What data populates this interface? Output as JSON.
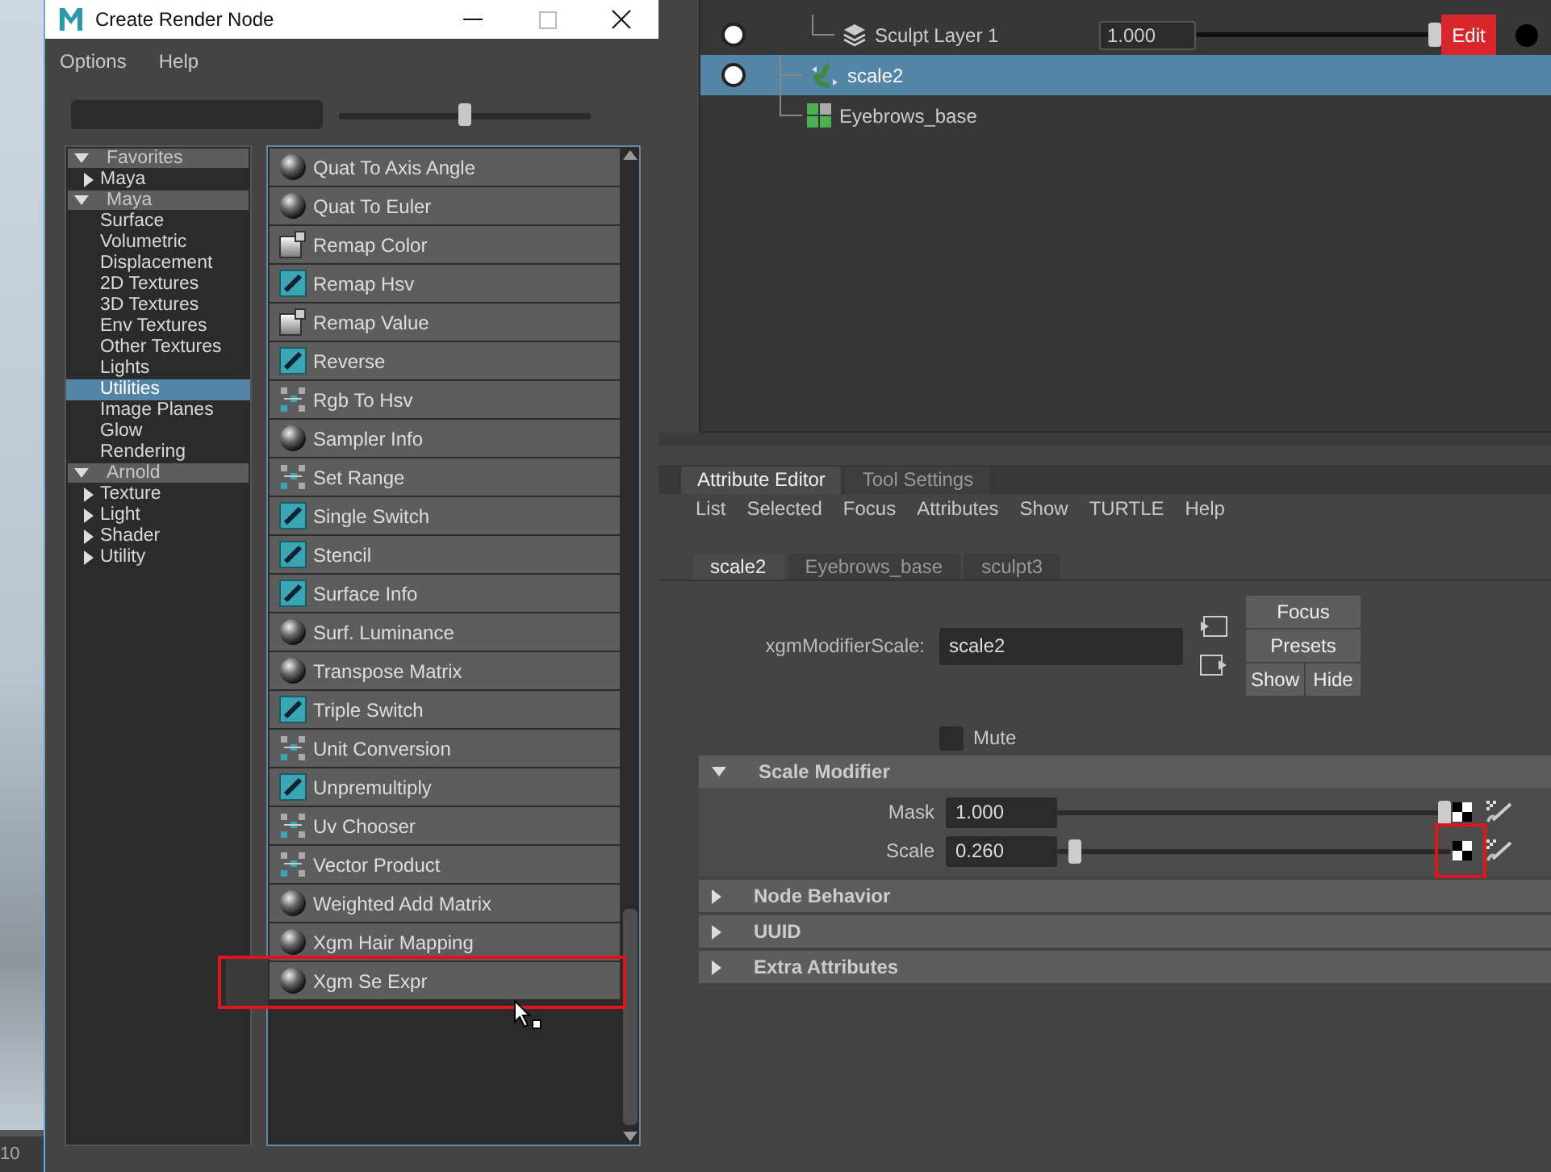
{
  "desktop": {
    "corner_text": "10"
  },
  "create_render_node": {
    "window": {
      "title": "Create Render Node"
    },
    "menu": [
      "Options",
      "Help"
    ],
    "size_slider": {
      "level": 0.5
    },
    "tree": [
      {
        "label": "Favorites",
        "expanded": true,
        "selected": false,
        "children": [
          {
            "label": "Maya",
            "expanded": false,
            "selected": false
          }
        ]
      },
      {
        "label": "Maya",
        "expanded": true,
        "selected": false,
        "children": [
          {
            "label": "Surface",
            "selected": false
          },
          {
            "label": "Volumetric",
            "selected": false
          },
          {
            "label": "Displacement",
            "selected": false
          },
          {
            "label": "2D Textures",
            "selected": false
          },
          {
            "label": "3D Textures",
            "selected": false
          },
          {
            "label": "Env Textures",
            "selected": false
          },
          {
            "label": "Other Textures",
            "selected": false
          },
          {
            "label": "Lights",
            "selected": false
          },
          {
            "label": "Utilities",
            "selected": true
          },
          {
            "label": "Image Planes",
            "selected": false
          },
          {
            "label": "Glow",
            "selected": false
          },
          {
            "label": "Rendering",
            "selected": false
          }
        ]
      },
      {
        "label": "Arnold",
        "expanded": true,
        "selected": false,
        "children": [
          {
            "label": "Texture",
            "expanded": false,
            "selected": false
          },
          {
            "label": "Light",
            "expanded": false,
            "selected": false
          },
          {
            "label": "Shader",
            "expanded": false,
            "selected": false
          },
          {
            "label": "Utility",
            "expanded": false,
            "selected": false
          }
        ]
      }
    ],
    "nodes": [
      {
        "label": "Quat To Axis Angle",
        "kind": "sphere",
        "highlighted": false
      },
      {
        "label": "Quat To Euler",
        "kind": "sphere",
        "highlighted": false
      },
      {
        "label": "Remap Color",
        "kind": "ramp",
        "highlighted": false
      },
      {
        "label": "Remap Hsv",
        "kind": "swatch",
        "highlighted": false
      },
      {
        "label": "Remap Value",
        "kind": "ramp",
        "highlighted": false
      },
      {
        "label": "Reverse",
        "kind": "swatch",
        "highlighted": false
      },
      {
        "label": "Rgb To Hsv",
        "kind": "pattern",
        "highlighted": false
      },
      {
        "label": "Sampler Info",
        "kind": "sphere",
        "highlighted": false
      },
      {
        "label": "Set Range",
        "kind": "pattern",
        "highlighted": false
      },
      {
        "label": "Single Switch",
        "kind": "swatch",
        "highlighted": false
      },
      {
        "label": "Stencil",
        "kind": "swatch",
        "highlighted": false
      },
      {
        "label": "Surface Info",
        "kind": "swatch",
        "highlighted": false
      },
      {
        "label": "Surf. Luminance",
        "kind": "sphere",
        "highlighted": false
      },
      {
        "label": "Transpose Matrix",
        "kind": "sphere",
        "highlighted": false
      },
      {
        "label": "Triple Switch",
        "kind": "swatch",
        "highlighted": false
      },
      {
        "label": "Unit Conversion",
        "kind": "pattern",
        "highlighted": false
      },
      {
        "label": "Unpremultiply",
        "kind": "swatch",
        "highlighted": false
      },
      {
        "label": "Uv Chooser",
        "kind": "pattern",
        "highlighted": false
      },
      {
        "label": "Vector Product",
        "kind": "pattern",
        "highlighted": false
      },
      {
        "label": "Weighted Add Matrix",
        "kind": "sphere",
        "highlighted": false
      },
      {
        "label": "Xgm Hair Mapping",
        "kind": "sphere",
        "highlighted": false
      },
      {
        "label": "Xgm Se Expr",
        "kind": "sphere",
        "highlighted": true
      }
    ]
  },
  "outliner": {
    "rows": [
      {
        "kind": "layer",
        "label": "Sculpt Layer 1",
        "value": "1.000",
        "level": 1,
        "button": "Edit",
        "selected": false
      },
      {
        "kind": "modifier",
        "label": "scale2",
        "selected": true
      },
      {
        "kind": "base",
        "label": "Eyebrows_base",
        "selected": false
      }
    ]
  },
  "attribute_editor": {
    "tabs": [
      {
        "label": "Attribute Editor",
        "selected": true
      },
      {
        "label": "Tool Settings",
        "selected": false
      }
    ],
    "menu": [
      "List",
      "Selected",
      "Focus",
      "Attributes",
      "Show",
      "TURTLE",
      "Help"
    ],
    "node_tabs": [
      {
        "label": "scale2",
        "selected": true
      },
      {
        "label": "Eyebrows_base",
        "selected": false
      },
      {
        "label": "sculpt3",
        "selected": false
      }
    ],
    "node": {
      "label": "xgmModifierScale:",
      "value": "scale2"
    },
    "buttons": [
      "Focus",
      "Presets",
      "Show",
      "Hide"
    ],
    "mute": {
      "label": "Mute",
      "checked": false
    },
    "sections": [
      {
        "title": "Scale Modifier",
        "expanded": true,
        "attributes": [
          {
            "label": "Mask",
            "value": "1.000",
            "level": 1,
            "highlighted": false
          },
          {
            "label": "Scale",
            "value": "0.260",
            "level": 0.03,
            "highlighted": true
          }
        ]
      },
      {
        "title": "Node Behavior",
        "expanded": false
      },
      {
        "title": "UUID",
        "expanded": false
      },
      {
        "title": "Extra Attributes",
        "expanded": false
      }
    ]
  }
}
